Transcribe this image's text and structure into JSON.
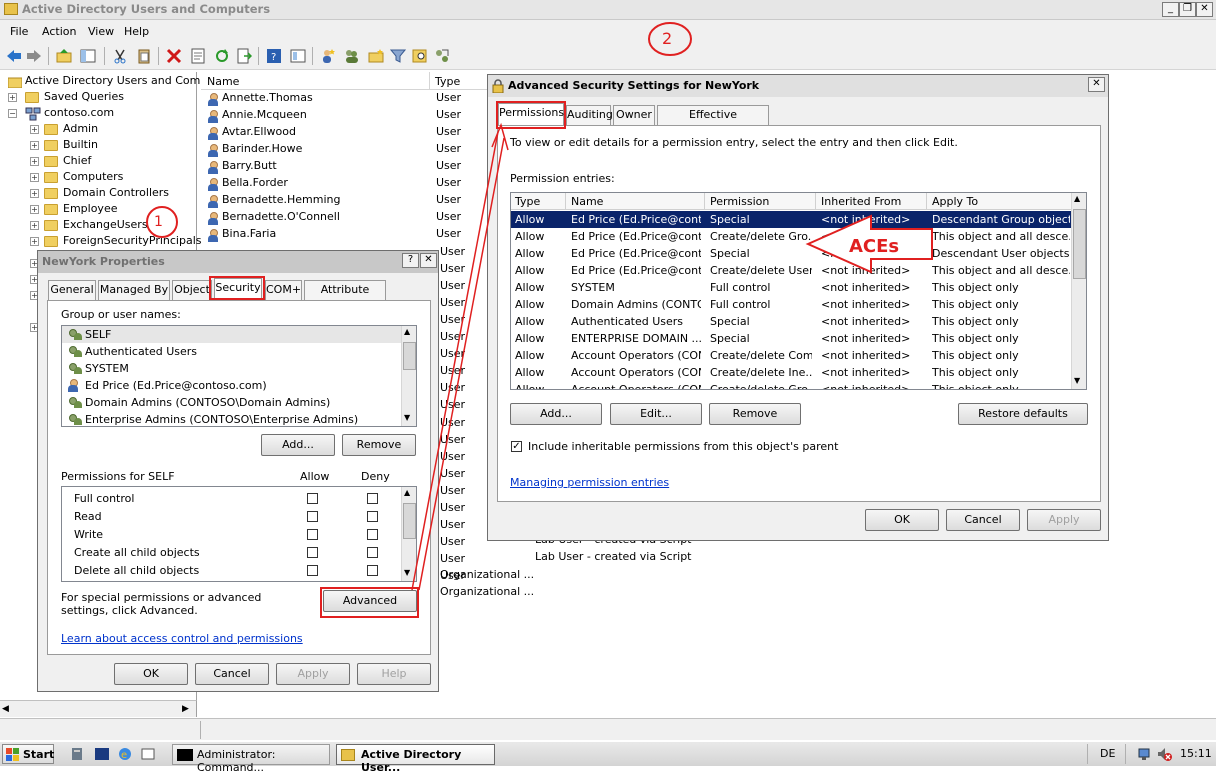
{
  "window": {
    "title": "Active Directory Users and Computers",
    "min": "_",
    "restore": "❐",
    "close": "✕"
  },
  "menu": [
    "File",
    "Action",
    "View",
    "Help"
  ],
  "annotations": {
    "step1": "1",
    "step2": "2",
    "aces": "ACEs"
  },
  "tree": {
    "root": "Active Directory Users and Comput",
    "saved_queries": "Saved Queries",
    "domain": "contoso.com",
    "children": [
      "Admin",
      "Builtin",
      "Chief",
      "Computers",
      "Domain Controllers",
      "Employee",
      "ExchangeUsers",
      "ForeignSecurityPrincipals"
    ]
  },
  "list": {
    "col_name": "Name",
    "col_type": "Type",
    "rows": [
      {
        "name": "Annette.Thomas",
        "type": "User"
      },
      {
        "name": "Annie.Mcqueen",
        "type": "User"
      },
      {
        "name": "Avtar.Ellwood",
        "type": "User"
      },
      {
        "name": "Barinder.Howe",
        "type": "User"
      },
      {
        "name": "Barry.Butt",
        "type": "User"
      },
      {
        "name": "Bella.Forder",
        "type": "User"
      },
      {
        "name": "Bernadette.Hemming",
        "type": "User"
      },
      {
        "name": "Bernadette.O'Connell",
        "type": "User"
      },
      {
        "name": "Bina.Faria",
        "type": "User"
      }
    ],
    "tail_types": [
      "User",
      "User",
      "User",
      "User",
      "User",
      "User",
      "User",
      "User",
      "User",
      "User",
      "User",
      "User",
      "User",
      "User",
      "User",
      "User",
      "User",
      "User",
      "User",
      "User"
    ],
    "desc_rows": [
      "Lab User - created via Script",
      "Lab User - created via Script"
    ],
    "org_rows": [
      "Organizational ...",
      "Organizational ..."
    ]
  },
  "props": {
    "title": "NewYork Properties",
    "help_btn": "?",
    "close_btn": "✕",
    "tabs": [
      "General",
      "Managed By",
      "Object",
      "Security",
      "COM+",
      "Attribute Editor"
    ],
    "group_label": "Group or user names:",
    "principals": [
      "SELF",
      "Authenticated Users",
      "SYSTEM",
      "Ed Price (Ed.Price@contoso.com)",
      "Domain Admins (CONTOSO\\Domain Admins)",
      "Enterprise Admins (CONTOSO\\Enterprise Admins)"
    ],
    "add": "Add...",
    "remove": "Remove",
    "perms_label": "Permissions for SELF",
    "allow": "Allow",
    "deny": "Deny",
    "perms": [
      "Full control",
      "Read",
      "Write",
      "Create all child objects",
      "Delete all child objects"
    ],
    "special_text": "For special permissions or advanced settings, click Advanced.",
    "advanced": "Advanced",
    "learn_link": "Learn about access control and permissions",
    "ok": "OK",
    "cancel": "Cancel",
    "apply": "Apply",
    "help": "Help"
  },
  "adv": {
    "title": "Advanced Security Settings for NewYork",
    "close_btn": "✕",
    "tabs": [
      "Permissions",
      "Auditing",
      "Owner",
      "Effective Permissions"
    ],
    "instructions": "To view or edit details for a permission entry, select the entry and then click Edit.",
    "entries_label": "Permission entries:",
    "cols": [
      "Type",
      "Name",
      "Permission",
      "Inherited From",
      "Apply To"
    ],
    "rows": [
      [
        "Allow",
        "Ed Price (Ed.Price@conto...",
        "Special",
        "<not inherited>",
        "Descendant Group objects"
      ],
      [
        "Allow",
        "Ed Price (Ed.Price@conto...",
        "Create/delete Gro...",
        "<not inherited>",
        "This object and all desce..."
      ],
      [
        "Allow",
        "Ed Price (Ed.Price@conto...",
        "Special",
        "<not inherited>",
        "Descendant User objects"
      ],
      [
        "Allow",
        "Ed Price (Ed.Price@conto...",
        "Create/delete User...",
        "<not inherited>",
        "This object and all desce..."
      ],
      [
        "Allow",
        "SYSTEM",
        "Full control",
        "<not inherited>",
        "This object only"
      ],
      [
        "Allow",
        "Domain Admins (CONTOS...",
        "Full control",
        "<not inherited>",
        "This object only"
      ],
      [
        "Allow",
        "Authenticated Users",
        "Special",
        "<not inherited>",
        "This object only"
      ],
      [
        "Allow",
        "ENTERPRISE DOMAIN ...",
        "Special",
        "<not inherited>",
        "This object only"
      ],
      [
        "Allow",
        "Account Operators (CON...",
        "Create/delete Com...",
        "<not inherited>",
        "This object only"
      ],
      [
        "Allow",
        "Account Operators (CON...",
        "Create/delete Ine...",
        "<not inherited>",
        "This object only"
      ],
      [
        "Allow",
        "Account Operators (CON...",
        "Create/delete Gro...",
        "<not inherited>",
        "This object only"
      ]
    ],
    "add": "Add...",
    "edit": "Edit...",
    "remove": "Remove",
    "restore": "Restore defaults",
    "include_label": "Include inheritable permissions from this object's parent",
    "include_checked": true,
    "manage_link": "Managing permission entries",
    "ok": "OK",
    "cancel": "Cancel",
    "apply": "Apply"
  },
  "taskbar": {
    "start": "Start",
    "task1": "Administrator: Command...",
    "task2": "Active Directory User...",
    "lang": "DE",
    "clock": "15:11"
  },
  "colors": {
    "accent": "#e02020",
    "selection": "#0a246a",
    "link": "#0033cc"
  }
}
